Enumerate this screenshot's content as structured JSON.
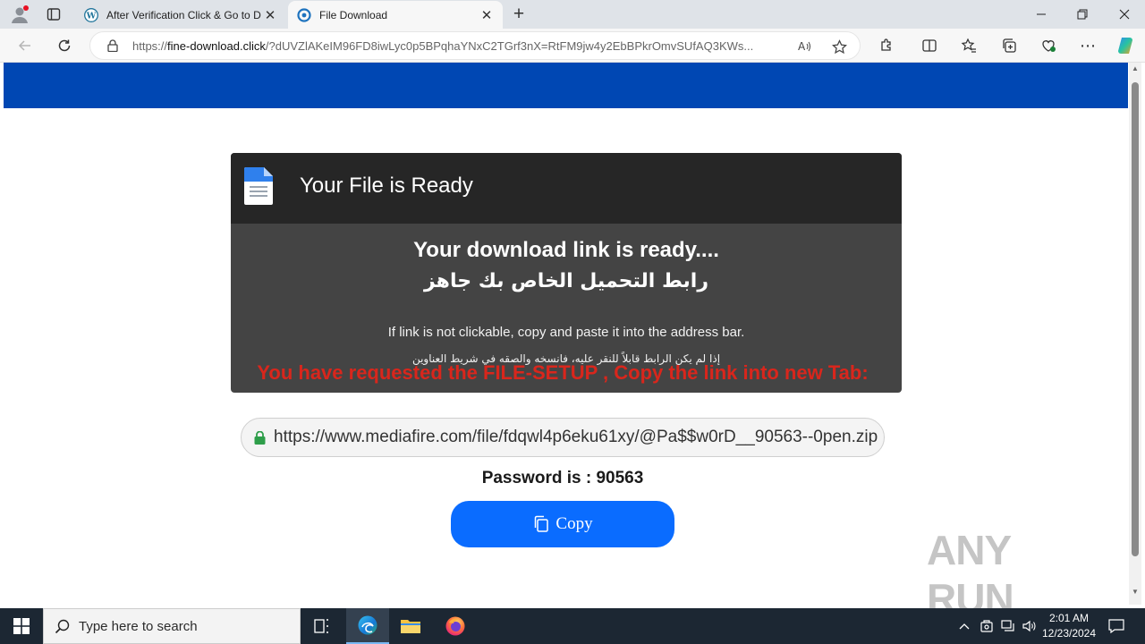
{
  "browser": {
    "tabs": [
      {
        "title": "After Verification Click & Go to D",
        "active": false
      },
      {
        "title": "File Download",
        "active": true
      }
    ],
    "url_prefix": "https://",
    "url_host": "fine-download.click",
    "url_rest": "/?dUVZlAKeIM96FD8iwLyc0p5BPqhaYNxC2TGrf3nX=RtFM9jw4y2EbBPkrOmvSUfAQ3KWs..."
  },
  "card": {
    "title": "Your File is Ready",
    "ready_en": "Your download link is ready....",
    "ready_ar": "رابط التحميل الخاص بك جاهز",
    "hint_en": "If link is not clickable, copy and paste it into the address bar.",
    "hint_ar": "إذا لم يكن الرابط قابلاً للنقر عليه، فانسخه والصقه في شريط العناوين"
  },
  "request": {
    "message": "You have requested the FILE-SETUP , Copy the link into new Tab:",
    "link": "https://www.mediafire.com/file/fdqwl4p6eku61xy/@Pa$$w0rD__90563--0pen.zip",
    "password_text": "Password is : 90563",
    "copy_label": "Copy"
  },
  "watermark": "ANY RUN",
  "taskbar": {
    "search_placeholder": "Type here to search",
    "time": "2:01 AM",
    "date": "12/23/2024"
  },
  "colors": {
    "banner": "#0047b3",
    "card": "#444444",
    "card_header": "#262626",
    "request_text": "#d9261c",
    "copy_button": "#0a6cff"
  }
}
